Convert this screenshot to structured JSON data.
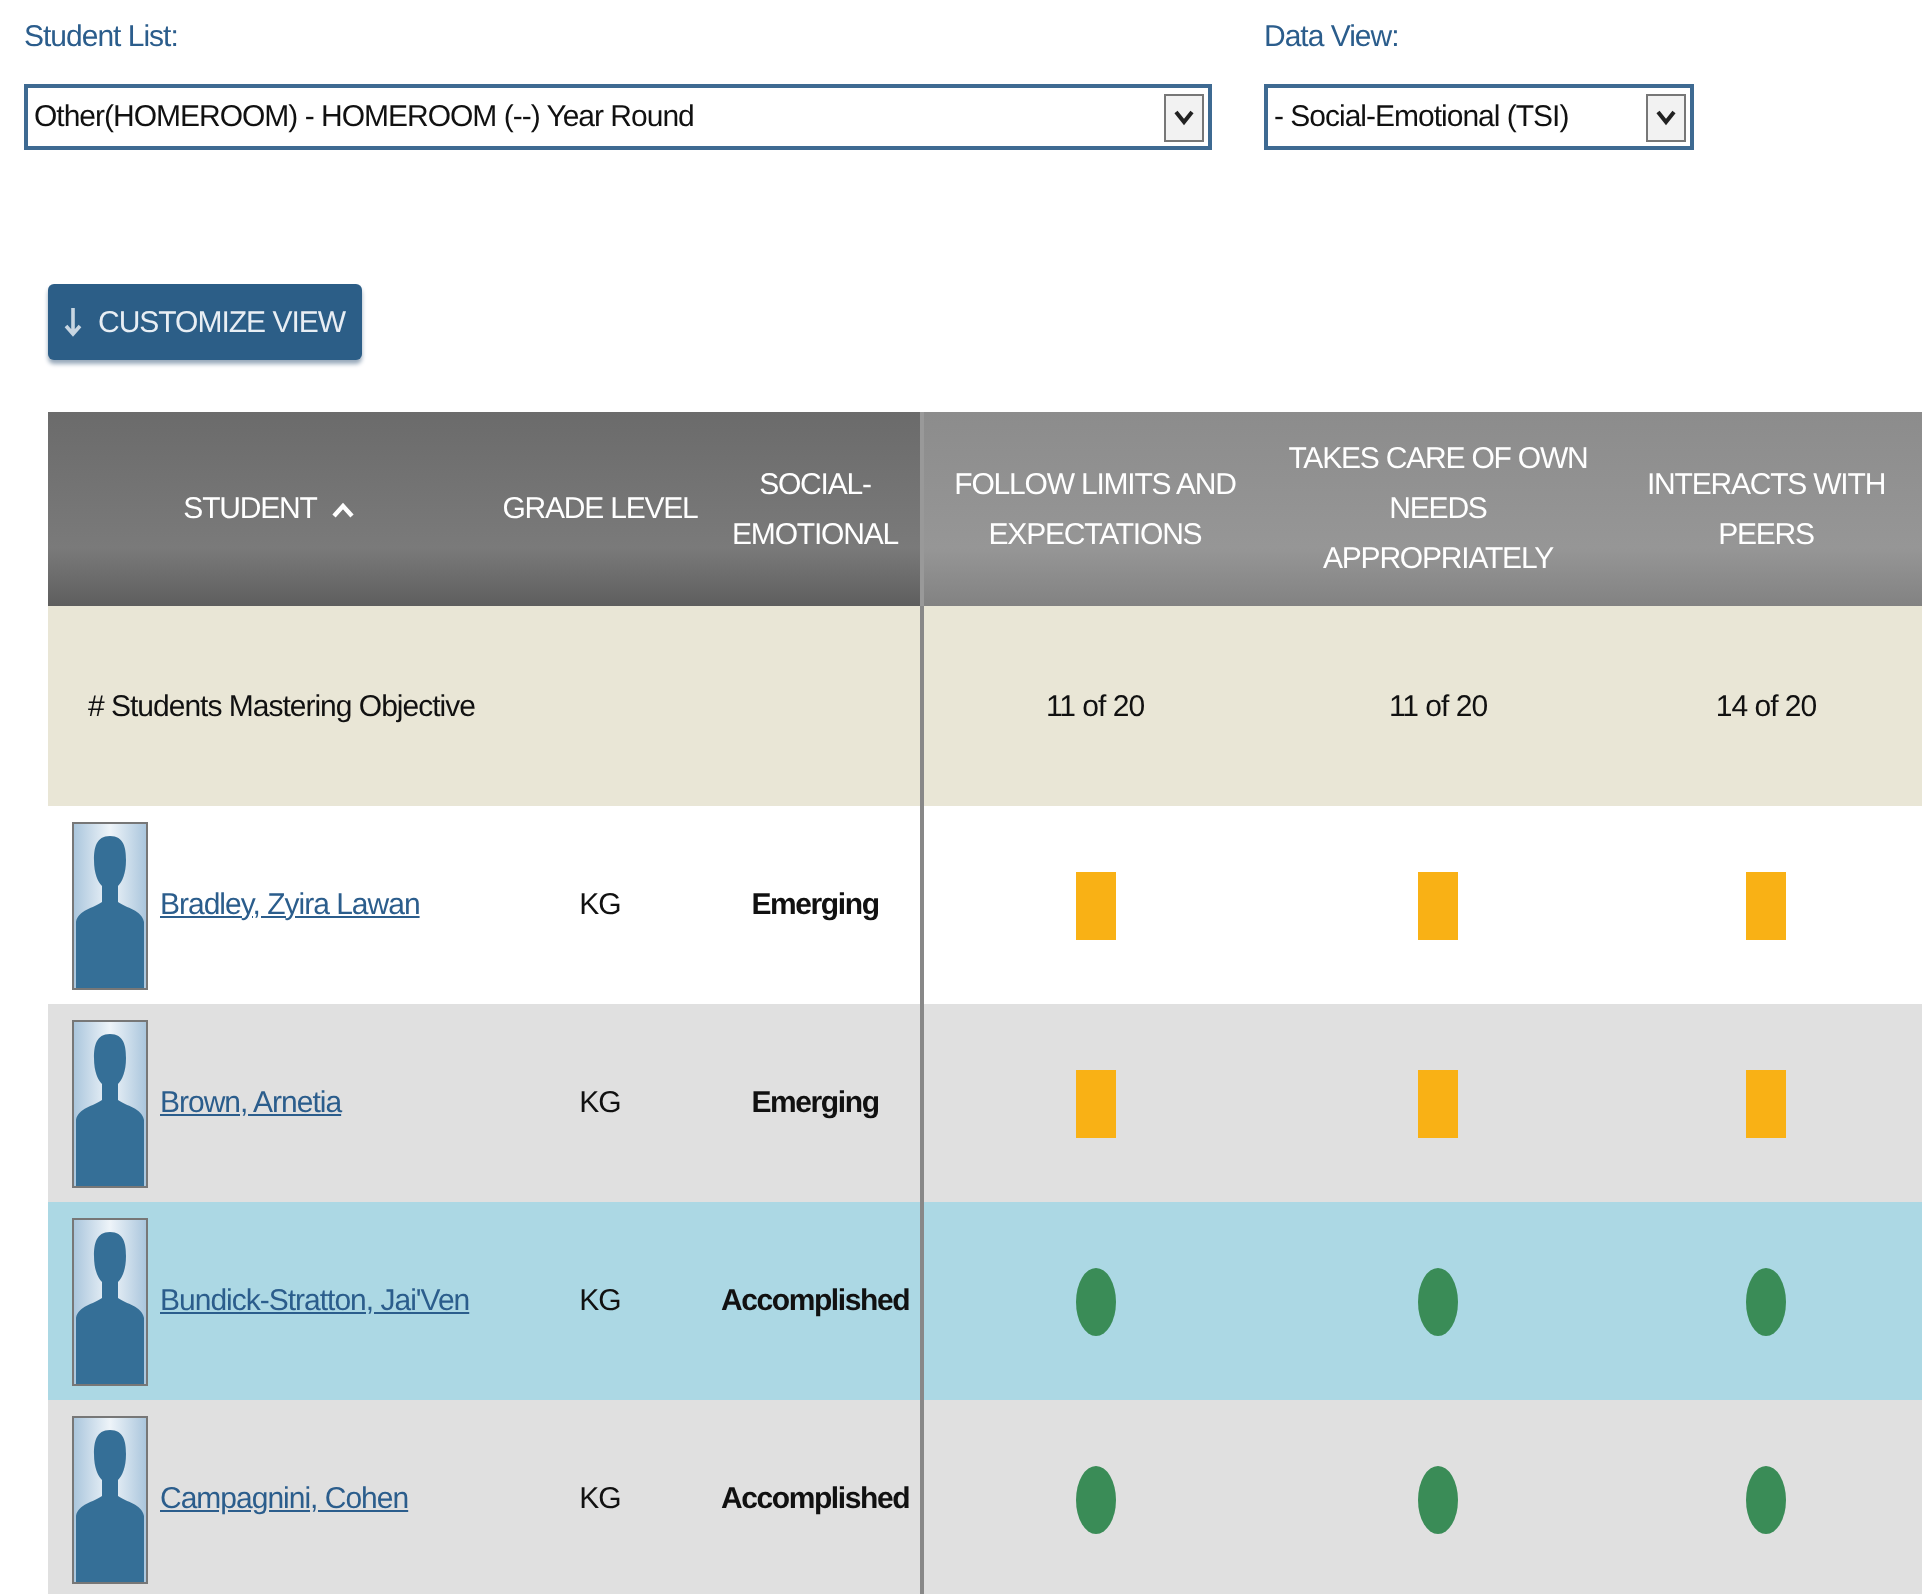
{
  "filters": [
    {
      "label": "Student List:",
      "value": "Other(HOMEROOM) - HOMEROOM (--) Year Round"
    },
    {
      "label": "Data View:",
      "value": "- Social-Emotional (TSI)"
    }
  ],
  "customize_button": "CUSTOMIZE VIEW",
  "table": {
    "columns": [
      {
        "label": "STUDENT",
        "sorted": true,
        "kind": "info"
      },
      {
        "label": "GRADE LEVEL",
        "sorted": false,
        "kind": "info"
      },
      {
        "label": "SOCIAL-EMOTIONAL",
        "sorted": false,
        "kind": "info"
      },
      {
        "label": "FOLLOW LIMITS AND EXPECTATIONS",
        "sorted": false,
        "kind": "objective"
      },
      {
        "label": "TAKES CARE OF OWN NEEDS APPROPRIATELY",
        "sorted": false,
        "kind": "objective"
      },
      {
        "label": "INTERACTS WITH PEERS",
        "sorted": false,
        "kind": "objective"
      }
    ],
    "summary": {
      "label": "# Students Mastering Objective",
      "values": [
        "11 of 20",
        "11 of 20",
        "14 of 20"
      ]
    },
    "rows": [
      {
        "name": "Bradley, Zyira Lawan",
        "grade": "KG",
        "status": "Emerging",
        "selected": false,
        "marks": [
          {
            "kind": "square",
            "color": "#f9b115"
          },
          {
            "kind": "square",
            "color": "#f9b115"
          },
          {
            "kind": "square",
            "color": "#f9b115"
          }
        ]
      },
      {
        "name": "Brown, Arnetia",
        "grade": "KG",
        "status": "Emerging",
        "selected": false,
        "marks": [
          {
            "kind": "square",
            "color": "#f9b115"
          },
          {
            "kind": "square",
            "color": "#f9b115"
          },
          {
            "kind": "square",
            "color": "#f9b115"
          }
        ]
      },
      {
        "name": "Bundick-Stratton, Jai'Ven",
        "grade": "KG",
        "status": "Accomplished",
        "selected": true,
        "marks": [
          {
            "kind": "circle",
            "color": "#3a8c57"
          },
          {
            "kind": "circle",
            "color": "#3a8c57"
          },
          {
            "kind": "circle",
            "color": "#3a8c57"
          }
        ]
      },
      {
        "name": "Campagnini, Cohen",
        "grade": "KG",
        "status": "Accomplished",
        "selected": false,
        "marks": [
          {
            "kind": "circle",
            "color": "#3a8c57"
          },
          {
            "kind": "circle",
            "color": "#3a8c57"
          },
          {
            "kind": "circle",
            "color": "#3a8c57"
          }
        ]
      }
    ]
  }
}
